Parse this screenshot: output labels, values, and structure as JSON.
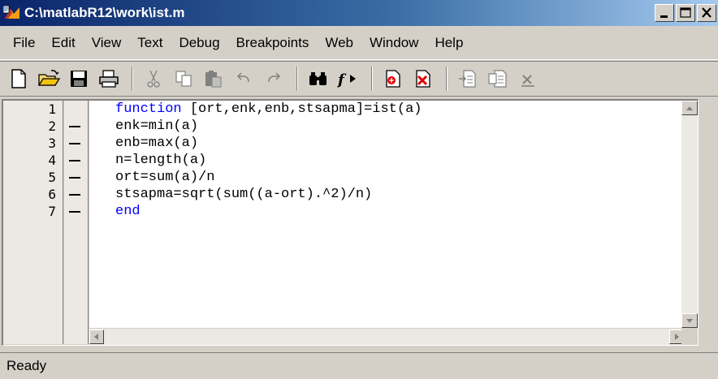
{
  "window": {
    "title": "C:\\matlabR12\\work\\ist.m",
    "minimize_label": "_",
    "maximize_label": "□",
    "close_label": "✕"
  },
  "menu": {
    "items": [
      "File",
      "Edit",
      "View",
      "Text",
      "Debug",
      "Breakpoints",
      "Web",
      "Window",
      "Help"
    ]
  },
  "toolbar": {
    "icons": [
      "new-file-icon",
      "open-folder-icon",
      "save-icon",
      "print-icon",
      "cut-icon",
      "copy-icon",
      "paste-icon",
      "undo-icon",
      "redo-icon",
      "find-icon",
      "function-icon",
      "set-breakpoint-icon",
      "clear-breakpoint-icon",
      "step-icon",
      "step-in-icon",
      "close-partial-icon"
    ]
  },
  "editor": {
    "lines": [
      {
        "num": "1",
        "keyword": "function",
        "rest": " [ort,enk,enb,stsapma]=ist(a)",
        "breakable": false
      },
      {
        "num": "2",
        "keyword": "",
        "rest": "enk=min(a)",
        "breakable": true
      },
      {
        "num": "3",
        "keyword": "",
        "rest": "enb=max(a)",
        "breakable": true
      },
      {
        "num": "4",
        "keyword": "",
        "rest": "n=length(a)",
        "breakable": true
      },
      {
        "num": "5",
        "keyword": "",
        "rest": "ort=sum(a)/n",
        "breakable": true
      },
      {
        "num": "6",
        "keyword": "",
        "rest": "stsapma=sqrt(sum((a-ort).^2)/n)",
        "breakable": true
      },
      {
        "num": "7",
        "keyword": "end",
        "rest": "",
        "breakable": true
      }
    ]
  },
  "status": {
    "text": "Ready"
  },
  "colors": {
    "keyword": "#0000ff",
    "title_gradient_start": "#0a246a",
    "title_gradient_end": "#a6caf0",
    "chrome": "#d4d0c8"
  }
}
